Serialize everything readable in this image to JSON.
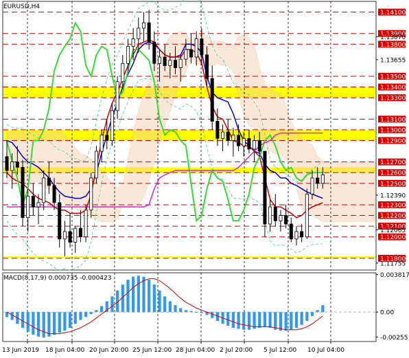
{
  "window": {
    "title": "EURUSD,H4"
  },
  "chart_data": [
    {
      "type": "candlestick",
      "title": "EURUSD,H4",
      "ylim": [
        1.1169,
        1.142
      ],
      "categories": [
        "13 Jun 2019",
        "18 Jun 04:00",
        "20 Jun 20:00",
        "25 Jun 12:00",
        "28 Jun 04:00",
        "2 Jul 20:00",
        "5 Jul 12:00",
        "10 Jul 04:00"
      ],
      "price_labels": {
        "levels": [
          "1.14100",
          "1.13900",
          "1.13800",
          "1.13500",
          "1.13400",
          "1.13300",
          "1.13100",
          "1.13000",
          "1.12900",
          "1.12700",
          "1.12600",
          "1.12500",
          "1.12300",
          "1.12200",
          "1.12100",
          "1.12000",
          "1.11800"
        ],
        "highlighted": [
          "1.14100",
          "1.13900",
          "1.13800",
          "1.13500",
          "1.13400",
          "1.13300",
          "1.13100",
          "1.13000",
          "1.12900",
          "1.12700",
          "1.12600",
          "1.12500",
          "1.12300",
          "1.12200",
          "1.12100",
          "1.12000",
          "1.11800"
        ],
        "plain": [
          "1.13870",
          "1.13655",
          "1.12390",
          "1.12065",
          "1.11755"
        ]
      },
      "candles": [
        [
          1.1275,
          1.129,
          1.1255,
          1.1262
        ],
        [
          1.1262,
          1.1278,
          1.1245,
          1.127
        ],
        [
          1.127,
          1.1285,
          1.1258,
          1.1265
        ],
        [
          1.1265,
          1.1272,
          1.121,
          1.1218
        ],
        [
          1.1218,
          1.1245,
          1.1205,
          1.1238
        ],
        [
          1.1238,
          1.125,
          1.122,
          1.1228
        ],
        [
          1.1228,
          1.124,
          1.1212,
          1.1232
        ],
        [
          1.1232,
          1.1262,
          1.1225,
          1.1255
        ],
        [
          1.1255,
          1.127,
          1.124,
          1.1248
        ],
        [
          1.1248,
          1.1255,
          1.1225,
          1.1232
        ],
        [
          1.1232,
          1.124,
          1.119,
          1.1198
        ],
        [
          1.1198,
          1.1215,
          1.1182,
          1.1205
        ],
        [
          1.1205,
          1.1222,
          1.119,
          1.1195
        ],
        [
          1.1195,
          1.121,
          1.1185,
          1.1208
        ],
        [
          1.1208,
          1.1225,
          1.1195,
          1.12
        ],
        [
          1.12,
          1.123,
          1.1195,
          1.1225
        ],
        [
          1.1225,
          1.126,
          1.1218,
          1.1255
        ],
        [
          1.1255,
          1.1285,
          1.125,
          1.128
        ],
        [
          1.128,
          1.13,
          1.127,
          1.1295
        ],
        [
          1.1295,
          1.131,
          1.1282,
          1.129
        ],
        [
          1.129,
          1.1325,
          1.1285,
          1.1318
        ],
        [
          1.1318,
          1.135,
          1.131,
          1.1345
        ],
        [
          1.1345,
          1.137,
          1.1338,
          1.1362
        ],
        [
          1.1362,
          1.1385,
          1.1355,
          1.1378
        ],
        [
          1.1378,
          1.1395,
          1.1365,
          1.1385
        ],
        [
          1.1385,
          1.1405,
          1.1372,
          1.1395
        ],
        [
          1.1395,
          1.141,
          1.1382,
          1.14
        ],
        [
          1.14,
          1.1412,
          1.1375,
          1.1382
        ],
        [
          1.1382,
          1.1392,
          1.1355,
          1.1362
        ],
        [
          1.1362,
          1.1375,
          1.1345,
          1.1368
        ],
        [
          1.1368,
          1.138,
          1.1355,
          1.136
        ],
        [
          1.136,
          1.1372,
          1.1348,
          1.1365
        ],
        [
          1.1365,
          1.1378,
          1.1352,
          1.1358
        ],
        [
          1.1358,
          1.137,
          1.1345,
          1.1366
        ],
        [
          1.1366,
          1.1385,
          1.136,
          1.1375
        ],
        [
          1.1375,
          1.139,
          1.1362,
          1.1368
        ],
        [
          1.1368,
          1.1392,
          1.136,
          1.1385
        ],
        [
          1.1385,
          1.1395,
          1.1362,
          1.137
        ],
        [
          1.137,
          1.1378,
          1.134,
          1.1348
        ],
        [
          1.1348,
          1.136,
          1.13,
          1.1308
        ],
        [
          1.1308,
          1.132,
          1.1285,
          1.1292
        ],
        [
          1.1292,
          1.1305,
          1.128,
          1.1298
        ],
        [
          1.1298,
          1.131,
          1.1285,
          1.129
        ],
        [
          1.129,
          1.1302,
          1.1275,
          1.1295
        ],
        [
          1.1295,
          1.1305,
          1.128,
          1.1285
        ],
        [
          1.1285,
          1.1298,
          1.1275,
          1.1292
        ],
        [
          1.1292,
          1.13,
          1.1278,
          1.1282
        ],
        [
          1.1282,
          1.1295,
          1.127,
          1.129
        ],
        [
          1.129,
          1.1298,
          1.1275,
          1.128
        ],
        [
          1.128,
          1.1262,
          1.12,
          1.1212
        ],
        [
          1.1212,
          1.1235,
          1.1205,
          1.1228
        ],
        [
          1.1228,
          1.124,
          1.121,
          1.1215
        ],
        [
          1.1215,
          1.1225,
          1.1205,
          1.122
        ],
        [
          1.122,
          1.123,
          1.1208,
          1.1212
        ],
        [
          1.1212,
          1.1218,
          1.1195,
          1.1198
        ],
        [
          1.1198,
          1.121,
          1.1192,
          1.1205
        ],
        [
          1.1205,
          1.1212,
          1.1195,
          1.12
        ],
        [
          1.12,
          1.1245,
          1.1198,
          1.124
        ],
        [
          1.124,
          1.1262,
          1.1235,
          1.1255
        ],
        [
          1.1255,
          1.1265,
          1.1245,
          1.125
        ],
        [
          1.125,
          1.1265,
          1.1245,
          1.1258
        ]
      ],
      "series": [
        {
          "name": "",
          "color": "#0000cc",
          "values": [
            1.129,
            1.1288,
            1.1282,
            1.1275,
            1.127,
            1.1268,
            1.1265,
            1.126,
            1.1255,
            1.1248,
            1.1242,
            1.1238,
            1.1237,
            1.1236,
            1.1236,
            1.1238,
            1.1245,
            1.126,
            1.1278,
            1.1295,
            1.1312,
            1.1325,
            1.134,
            1.1352,
            1.1362,
            1.1375,
            1.138,
            1.1382,
            1.138,
            1.1375,
            1.137,
            1.1368,
            1.1368,
            1.137,
            1.138,
            1.138,
            1.1378,
            1.1372,
            1.135,
            1.1335,
            1.133,
            1.1328,
            1.1326,
            1.1315,
            1.13,
            1.129,
            1.1285,
            1.128,
            1.1278,
            1.1268,
            1.1262,
            1.126,
            1.1255,
            1.1255,
            1.125,
            1.1248,
            1.1245,
            1.1242,
            1.124,
            1.1238,
            1.1236
          ]
        },
        {
          "name": "",
          "color": "#cc0000",
          "values": [
            1.126,
            1.1255,
            1.1252,
            1.125,
            1.1245,
            1.124,
            1.1236,
            1.1234,
            1.1232,
            1.1228,
            1.1225,
            1.1225,
            1.1222,
            1.1222,
            1.1222,
            1.1225,
            1.124,
            1.1265,
            1.129,
            1.131,
            1.1325,
            1.1335,
            1.1348,
            1.136,
            1.137,
            1.138,
            1.1382,
            1.1384,
            1.1382,
            1.1375,
            1.137,
            1.1368,
            1.1368,
            1.1368,
            1.1375,
            1.1375,
            1.1372,
            1.1362,
            1.134,
            1.1322,
            1.1312,
            1.131,
            1.13,
            1.129,
            1.1288,
            1.1285,
            1.1285,
            1.128,
            1.1275,
            1.1255,
            1.1235,
            1.1228,
            1.1228,
            1.1225,
            1.1222,
            1.1218,
            1.122,
            1.1225,
            1.1228,
            1.123,
            1.1232
          ]
        },
        {
          "name": "",
          "color": "#33dd33",
          "values": [
            1.129,
            1.127,
            1.1255,
            1.123,
            1.1245,
            1.129,
            1.129,
            1.13,
            1.132,
            1.1355,
            1.137,
            1.1378,
            1.1385,
            1.14,
            1.1392,
            1.136,
            1.135,
            1.137,
            1.1378,
            1.1375,
            1.135,
            1.133,
            1.1335,
            1.1355,
            1.1375,
            1.1375,
            1.137,
            1.1365,
            1.1345,
            1.131,
            1.1295,
            1.13,
            1.1298,
            1.129,
            1.1285,
            1.125,
            1.1215,
            1.122,
            1.1245,
            1.1262,
            1.1255,
            1.1252,
            1.1235,
            1.1215,
            1.1215,
            1.1225,
            1.124,
            1.1265,
            1.1275,
            1.129,
            1.1295,
            1.1285,
            1.127,
            1.1262,
            1.1265,
            1.1255,
            1.1252,
            1.1258,
            1.126,
            1.126,
            1.126
          ]
        },
        {
          "name": "",
          "color": "#dd22dd",
          "values": [
            1.1228,
            1.1228,
            1.1228,
            1.1228,
            1.1228,
            1.1228,
            1.1228,
            1.1228,
            1.1228,
            1.1228,
            1.1228,
            1.1228,
            1.1228,
            1.1228,
            1.1228,
            1.1228,
            1.1228,
            1.1228,
            1.1228,
            1.1228,
            1.1228,
            1.1228,
            1.1228,
            1.1228,
            1.1228,
            1.1228,
            1.1228,
            1.123,
            1.1245,
            1.1255,
            1.1258,
            1.126,
            1.1262,
            1.1262,
            1.1262,
            1.1262,
            1.1262,
            1.1262,
            1.1262,
            1.1262,
            1.1262,
            1.1262,
            1.1262,
            1.1262,
            1.1265,
            1.127,
            1.1275,
            1.128,
            1.1285,
            1.1288,
            1.129,
            1.1295,
            1.1297,
            1.1297,
            1.1297,
            1.1297,
            1.1297,
            1.1297,
            1.1297,
            1.1297,
            1.1297
          ]
        }
      ]
    },
    {
      "type": "bar",
      "title": "MACD(8,17,9) 0.000735 -0.000423",
      "ylim": [
        -0.003,
        0.004
      ],
      "tick_labels": [
        "0.003817",
        "0.00",
        "-0.00255"
      ],
      "series": [
        {
          "name": "histogram",
          "color": "#3399ee",
          "values": [
            -0.0005,
            -0.0008,
            -0.0012,
            -0.0016,
            -0.002,
            -0.0023,
            -0.0025,
            -0.0026,
            -0.0025,
            -0.0023,
            -0.0021,
            -0.0019,
            -0.0016,
            -0.0012,
            -0.0008,
            -0.0005,
            -0.0002,
            0.0002,
            0.0006,
            0.0011,
            0.0016,
            0.0022,
            0.0028,
            0.0033,
            0.0036,
            0.0037,
            0.0036,
            0.0033,
            0.0028,
            0.0022,
            0.0016,
            0.0011,
            0.0007,
            0.0004,
            0.0002,
            0.0001,
            0.0,
            -0.0001,
            -0.0003,
            -0.0006,
            -0.0009,
            -0.0012,
            -0.0014,
            -0.0016,
            -0.0017,
            -0.0018,
            -0.0018,
            -0.0017,
            -0.0016,
            -0.0015,
            -0.0016,
            -0.0018,
            -0.0019,
            -0.0019,
            -0.0018,
            -0.0016,
            -0.0013,
            -0.0009,
            -0.0004,
            0.0002,
            0.0007
          ]
        },
        {
          "name": "signal",
          "color": "#cc0000",
          "values": [
            0.0,
            -0.0003,
            -0.0006,
            -0.0009,
            -0.0012,
            -0.0015,
            -0.0018,
            -0.002,
            -0.0022,
            -0.0022,
            -0.0022,
            -0.0021,
            -0.002,
            -0.0018,
            -0.0016,
            -0.0013,
            -0.001,
            -0.0006,
            -0.0002,
            0.0002,
            0.0006,
            0.001,
            0.0015,
            0.002,
            0.0025,
            0.0029,
            0.0032,
            0.0034,
            0.0034,
            0.0032,
            0.0028,
            0.0024,
            0.0019,
            0.0014,
            0.001,
            0.0007,
            0.0004,
            0.0002,
            0.0,
            -0.0002,
            -0.0004,
            -0.0006,
            -0.0008,
            -0.001,
            -0.0012,
            -0.0013,
            -0.0014,
            -0.0015,
            -0.0015,
            -0.0015,
            -0.0015,
            -0.0016,
            -0.0017,
            -0.0018,
            -0.0018,
            -0.0018,
            -0.0017,
            -0.0015,
            -0.0012,
            -0.0008,
            -0.0004
          ]
        }
      ]
    }
  ]
}
